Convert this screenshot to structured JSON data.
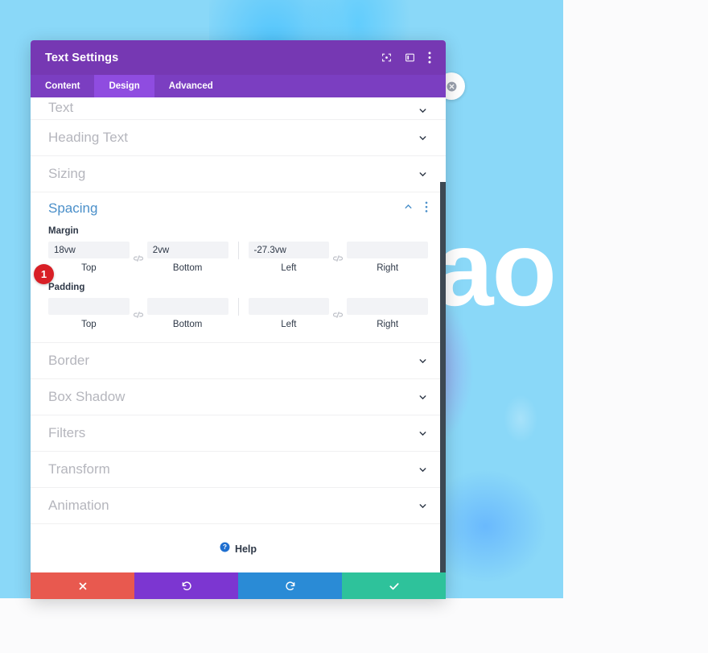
{
  "canvas": {
    "hero_word": "ao",
    "module_close_icon": "close-circle-icon"
  },
  "modal": {
    "title": "Text Settings",
    "header_icons": [
      {
        "name": "fullscreen-icon",
        "label": "Fullscreen"
      },
      {
        "name": "layout-panel-icon",
        "label": "Change panel position"
      },
      {
        "name": "more-vertical-icon",
        "label": "More options"
      }
    ],
    "tabs": [
      {
        "label": "Content",
        "active": false
      },
      {
        "label": "Design",
        "active": true
      },
      {
        "label": "Advanced",
        "active": false
      }
    ],
    "sections_above": [
      {
        "label": "Text",
        "state": "collapsed",
        "icon": "chevron-down-icon"
      },
      {
        "label": "Heading Text",
        "state": "collapsed",
        "icon": "chevron-down-icon"
      },
      {
        "label": "Sizing",
        "state": "collapsed",
        "icon": "chevron-down-icon"
      }
    ],
    "open_section": {
      "label": "Spacing",
      "collapse_icon": "chevron-up-icon",
      "menu_icon": "more-vertical-icon",
      "badge": "1",
      "groups": [
        {
          "title": "Margin",
          "link_icon": "broken-link-icon",
          "fields": [
            {
              "label": "Top",
              "value": "18vw",
              "placeholder": ""
            },
            {
              "label": "Bottom",
              "value": "2vw",
              "placeholder": ""
            },
            {
              "label": "Left",
              "value": "-27.3vw",
              "placeholder": ""
            },
            {
              "label": "Right",
              "value": "",
              "placeholder": ""
            }
          ]
        },
        {
          "title": "Padding",
          "link_icon": "broken-link-icon",
          "fields": [
            {
              "label": "Top",
              "value": "",
              "placeholder": ""
            },
            {
              "label": "Bottom",
              "value": "",
              "placeholder": ""
            },
            {
              "label": "Left",
              "value": "",
              "placeholder": ""
            },
            {
              "label": "Right",
              "value": "",
              "placeholder": ""
            }
          ]
        }
      ]
    },
    "sections_below": [
      {
        "label": "Border",
        "state": "collapsed",
        "icon": "chevron-down-icon"
      },
      {
        "label": "Box Shadow",
        "state": "collapsed",
        "icon": "chevron-down-icon"
      },
      {
        "label": "Filters",
        "state": "collapsed",
        "icon": "chevron-down-icon"
      },
      {
        "label": "Transform",
        "state": "collapsed",
        "icon": "chevron-down-icon"
      },
      {
        "label": "Animation",
        "state": "collapsed",
        "icon": "chevron-down-icon"
      }
    ],
    "help": {
      "label": "Help",
      "icon": "question-circle-icon"
    },
    "footer": [
      {
        "name": "discard-button",
        "icon": "x-icon",
        "color": "#e8594f"
      },
      {
        "name": "undo-button",
        "icon": "undo-icon",
        "color": "#7c36d1"
      },
      {
        "name": "redo-button",
        "icon": "redo-icon",
        "color": "#2a8bd6"
      },
      {
        "name": "save-button",
        "icon": "check-icon",
        "color": "#2ec29b"
      }
    ]
  },
  "colors": {
    "header_purple": "#7638b3",
    "tabs_purple": "#7b3ec1",
    "tab_active_purple": "#8f4ce0",
    "section_open_blue": "#4a8fc9",
    "badge_red": "#d81f26",
    "canvas_blue": "#8ad8f8"
  }
}
